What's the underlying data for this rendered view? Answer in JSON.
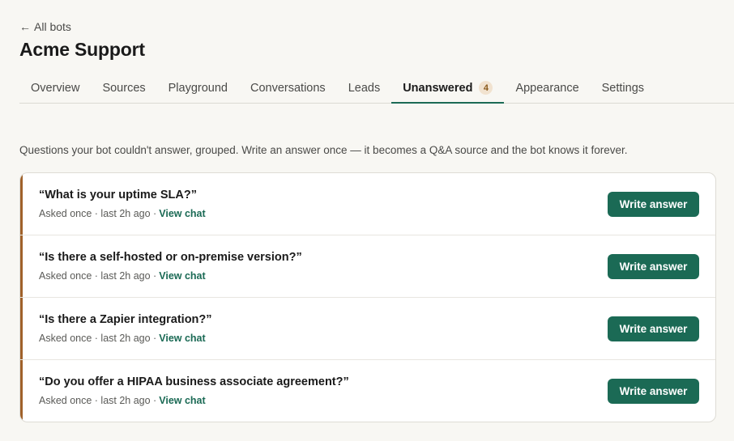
{
  "nav": {
    "back_arrow": "←",
    "back_label": "All bots"
  },
  "page": {
    "title": "Acme Support",
    "intro": "Questions your bot couldn't answer, grouped. Write an answer once — it becomes a Q&A source and the bot knows it forever."
  },
  "tabs": [
    {
      "label": "Overview",
      "active": false
    },
    {
      "label": "Sources",
      "active": false
    },
    {
      "label": "Playground",
      "active": false
    },
    {
      "label": "Conversations",
      "active": false
    },
    {
      "label": "Leads",
      "active": false
    },
    {
      "label": "Unanswered",
      "active": true,
      "badge": "4"
    },
    {
      "label": "Appearance",
      "active": false
    },
    {
      "label": "Settings",
      "active": false
    }
  ],
  "questions": [
    {
      "text": "“What is your uptime SLA?”",
      "asked": "Asked once · last 2h ago ·",
      "view_chat": "View chat",
      "action": "Write answer"
    },
    {
      "text": "“Is there a self-hosted or on-premise version?”",
      "asked": "Asked once · last 2h ago ·",
      "view_chat": "View chat",
      "action": "Write answer"
    },
    {
      "text": "“Is there a Zapier integration?”",
      "asked": "Asked once · last 2h ago ·",
      "view_chat": "View chat",
      "action": "Write answer"
    },
    {
      "text": "“Do you offer a HIPAA business associate agreement?”",
      "asked": "Asked once · last 2h ago ·",
      "view_chat": "View chat",
      "action": "Write answer"
    }
  ],
  "colors": {
    "accent": "#1b6a55",
    "row_marker": "#a0612a",
    "badge_bg": "#f1e2cf",
    "background": "#f8f7f3"
  }
}
